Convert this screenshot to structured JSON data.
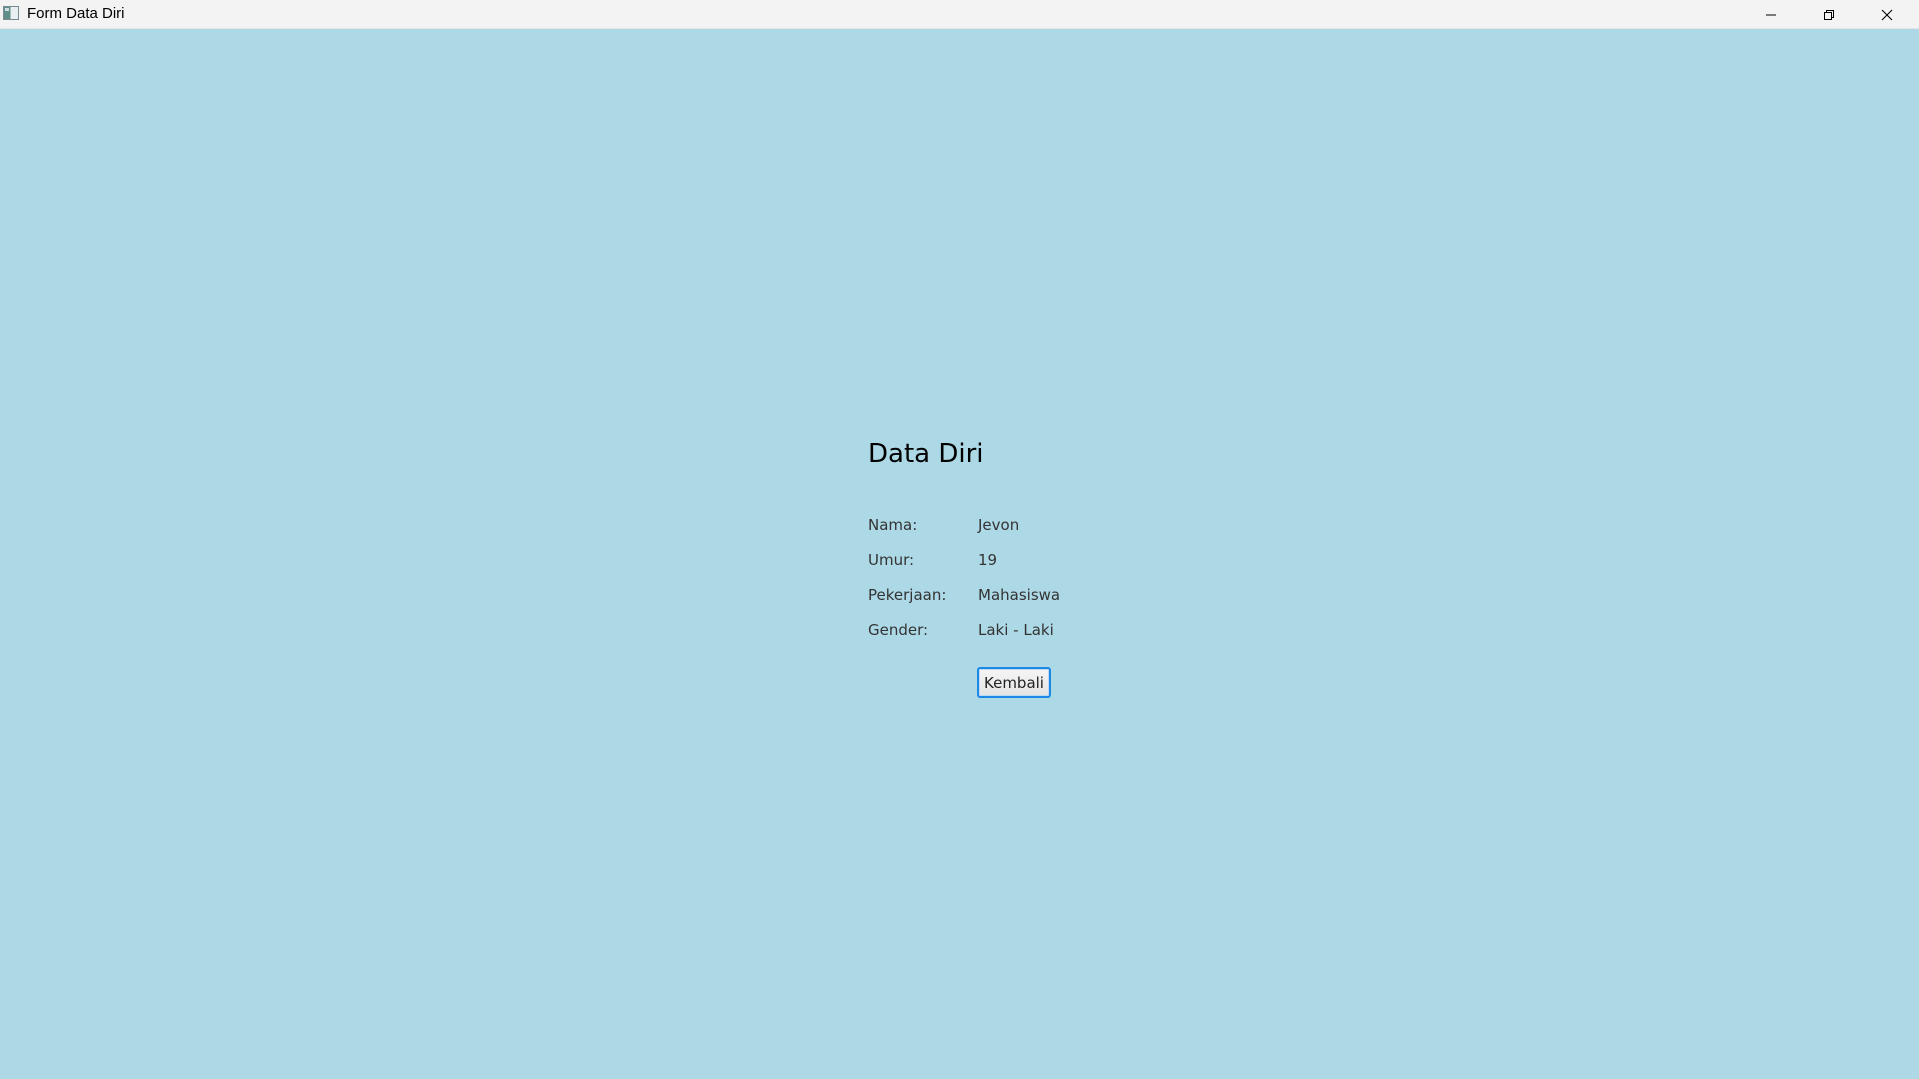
{
  "window": {
    "title": "Form Data Diri",
    "controls": {
      "minimize": "minimize-icon",
      "maximize": "restore-icon",
      "close": "close-icon"
    }
  },
  "form": {
    "title": "Data Diri",
    "fields": [
      {
        "label": "Nama:",
        "value": "Jevon"
      },
      {
        "label": "Umur:",
        "value": "19"
      },
      {
        "label": "Pekerjaan:",
        "value": "Mahasiswa"
      },
      {
        "label": "Gender:",
        "value": "Laki - Laki"
      }
    ],
    "back_button_label": "Kembali"
  },
  "colors": {
    "background": "#add8e6",
    "titlebar": "#f3f3f3",
    "button_focus_border": "#1e88e5"
  }
}
